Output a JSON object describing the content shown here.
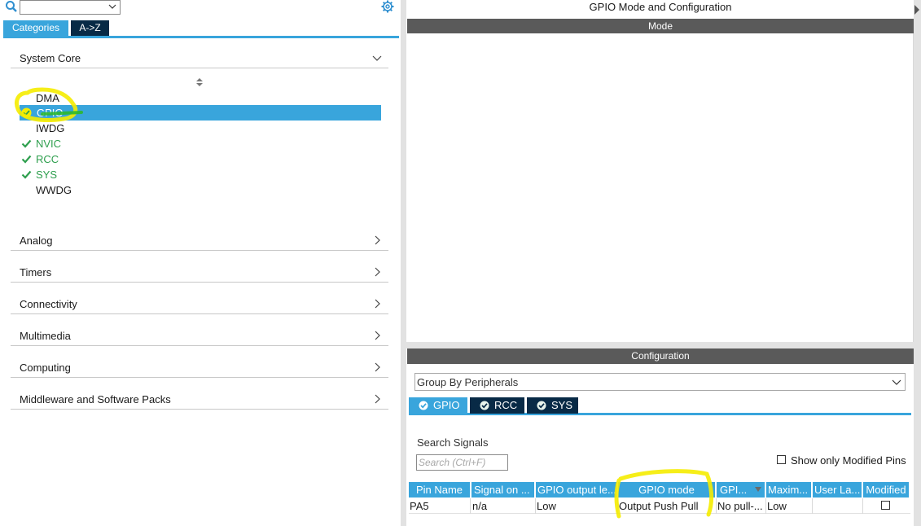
{
  "left": {
    "tabs": [
      {
        "label": "Categories",
        "active": true
      },
      {
        "label": "A->Z",
        "active": false
      }
    ],
    "search": {
      "value": ""
    },
    "categories": [
      {
        "label": "System Core",
        "expanded": true
      },
      {
        "label": "Analog",
        "expanded": false
      },
      {
        "label": "Timers",
        "expanded": false
      },
      {
        "label": "Connectivity",
        "expanded": false
      },
      {
        "label": "Multimedia",
        "expanded": false
      },
      {
        "label": "Computing",
        "expanded": false
      },
      {
        "label": "Middleware and Software Packs",
        "expanded": false
      }
    ],
    "system_core_items": [
      {
        "label": "DMA",
        "status": "none"
      },
      {
        "label": "GPIO",
        "status": "configured",
        "selected": true
      },
      {
        "label": "IWDG",
        "status": "none"
      },
      {
        "label": "NVIC",
        "status": "ok"
      },
      {
        "label": "RCC",
        "status": "ok"
      },
      {
        "label": "SYS",
        "status": "ok"
      },
      {
        "label": "WWDG",
        "status": "none"
      }
    ]
  },
  "right": {
    "title": "GPIO Mode and Configuration",
    "mode_header": "Mode",
    "config_header": "Configuration",
    "group_select": {
      "value": "Group By Peripherals"
    },
    "tabs": [
      {
        "label": "GPIO",
        "active": true
      },
      {
        "label": "RCC",
        "active": false
      },
      {
        "label": "SYS",
        "active": false
      }
    ],
    "search_signals": {
      "label": "Search Signals",
      "placeholder": "Search (Ctrl+F)"
    },
    "show_modified": {
      "label": "Show only Modified Pins",
      "checked": false
    },
    "table": {
      "columns": [
        "Pin Name",
        "Signal on ...",
        "GPIO output le...",
        "GPIO mode",
        "GPI...",
        "Maxim...",
        "User La...",
        "Modified"
      ],
      "rows": [
        {
          "cells": [
            "PA5",
            "n/a",
            "Low",
            "Output Push Pull",
            "No pull-...",
            "Low",
            ""
          ],
          "modified": false
        }
      ]
    }
  },
  "colors": {
    "accent": "#39a5dc",
    "dark_tab": "#082a46",
    "header_gray": "#5a5a5a",
    "ok_green": "#2e9f4e",
    "highlight": "#f5ec00"
  }
}
